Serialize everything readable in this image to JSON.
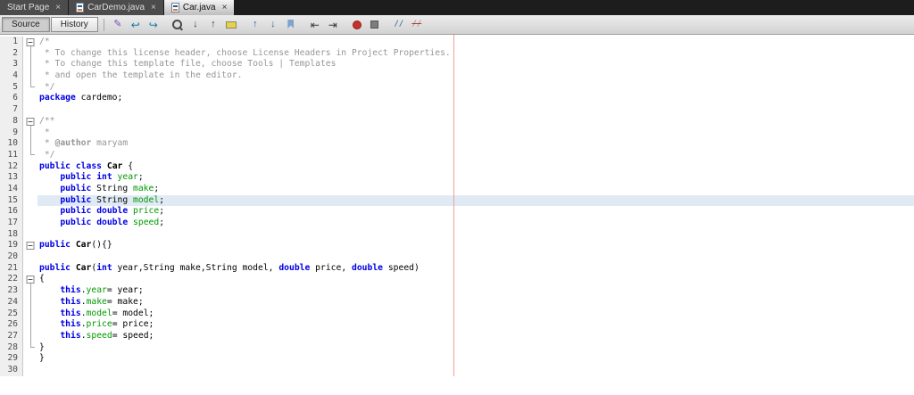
{
  "window": {
    "close_glyph": "×",
    "tabs": [
      {
        "label": "Start Page",
        "icon": "none",
        "active": false
      },
      {
        "label": "CarDemo.java",
        "icon": "java-file-icon",
        "active": false
      },
      {
        "label": "Car.java",
        "icon": "java-file-icon",
        "active": true
      }
    ]
  },
  "toolbar": {
    "source_label": "Source",
    "history_label": "History",
    "icon_groups": [
      [
        "last-edit",
        "back",
        "forward"
      ],
      [
        "find-selection",
        "find-next",
        "find-previous",
        "toggle-highlight"
      ],
      [
        "previous-bookmark",
        "next-bookmark",
        "toggle-bookmark"
      ],
      [
        "shift-left",
        "shift-right"
      ],
      [
        "start-macro",
        "stop-macro"
      ],
      [
        "comment",
        "uncomment"
      ]
    ]
  },
  "editor": {
    "language": "java",
    "line_count": 30,
    "margin_color": "#f49a9a",
    "lines": [
      {
        "f": "box",
        "t": [
          [
            "c",
            "/*"
          ]
        ]
      },
      {
        "f": "line",
        "t": [
          [
            "c",
            " * To change this license header, choose License Headers in Project Properties."
          ]
        ]
      },
      {
        "f": "line",
        "t": [
          [
            "c",
            " * To change this template file, choose Tools | Templates"
          ]
        ]
      },
      {
        "f": "line",
        "t": [
          [
            "c",
            " * and open the template in the editor."
          ]
        ]
      },
      {
        "f": "end",
        "t": [
          [
            "c",
            " */"
          ]
        ]
      },
      {
        "t": [
          [
            "k",
            "package"
          ],
          [
            "p",
            " cardemo;"
          ]
        ]
      },
      {
        "t": []
      },
      {
        "f": "box",
        "t": [
          [
            "c",
            "/**"
          ]
        ]
      },
      {
        "f": "line",
        "t": [
          [
            "c",
            " *"
          ]
        ]
      },
      {
        "f": "line",
        "t": [
          [
            "c",
            " * "
          ],
          [
            "cb",
            "@author"
          ],
          [
            "c",
            " maryam"
          ]
        ]
      },
      {
        "f": "end",
        "t": [
          [
            "c",
            " */"
          ]
        ]
      },
      {
        "t": [
          [
            "k",
            "public"
          ],
          [
            "p",
            " "
          ],
          [
            "k",
            "class"
          ],
          [
            "p",
            " "
          ],
          [
            "b",
            "Car"
          ],
          [
            "p",
            " {"
          ]
        ]
      },
      {
        "t": [
          [
            "p",
            "    "
          ],
          [
            "k",
            "public"
          ],
          [
            "p",
            " "
          ],
          [
            "k",
            "int"
          ],
          [
            "p",
            " "
          ],
          [
            "f",
            "year"
          ],
          [
            "p",
            ";"
          ]
        ]
      },
      {
        "t": [
          [
            "p",
            "    "
          ],
          [
            "k",
            "public"
          ],
          [
            "p",
            " String "
          ],
          [
            "f",
            "make"
          ],
          [
            "p",
            ";"
          ]
        ]
      },
      {
        "cur": true,
        "t": [
          [
            "p",
            "    "
          ],
          [
            "k",
            "public"
          ],
          [
            "p",
            " String "
          ],
          [
            "f",
            "model"
          ],
          [
            "p",
            ";"
          ]
        ]
      },
      {
        "t": [
          [
            "p",
            "    "
          ],
          [
            "k",
            "public"
          ],
          [
            "p",
            " "
          ],
          [
            "k",
            "double"
          ],
          [
            "p",
            " "
          ],
          [
            "f",
            "price"
          ],
          [
            "p",
            ";"
          ]
        ]
      },
      {
        "t": [
          [
            "p",
            "    "
          ],
          [
            "k",
            "public"
          ],
          [
            "p",
            " "
          ],
          [
            "k",
            "double"
          ],
          [
            "p",
            " "
          ],
          [
            "f",
            "speed"
          ],
          [
            "p",
            ";"
          ]
        ]
      },
      {
        "t": []
      },
      {
        "f": "box1",
        "t": [
          [
            "k",
            "public"
          ],
          [
            "p",
            " "
          ],
          [
            "b",
            "Car"
          ],
          [
            "p",
            "(){}"
          ]
        ]
      },
      {
        "t": []
      },
      {
        "t": [
          [
            "k",
            "public"
          ],
          [
            "p",
            " "
          ],
          [
            "b",
            "Car"
          ],
          [
            "p",
            "("
          ],
          [
            "k",
            "int"
          ],
          [
            "p",
            " year,String make,String model, "
          ],
          [
            "k",
            "double"
          ],
          [
            "p",
            " price, "
          ],
          [
            "k",
            "double"
          ],
          [
            "p",
            " speed)"
          ]
        ]
      },
      {
        "f": "box",
        "t": [
          [
            "p",
            "{"
          ]
        ]
      },
      {
        "f": "line",
        "t": [
          [
            "p",
            "    "
          ],
          [
            "k",
            "this"
          ],
          [
            "p",
            "."
          ],
          [
            "f",
            "year"
          ],
          [
            "p",
            "= year;"
          ]
        ]
      },
      {
        "f": "line",
        "t": [
          [
            "p",
            "    "
          ],
          [
            "k",
            "this"
          ],
          [
            "p",
            "."
          ],
          [
            "f",
            "make"
          ],
          [
            "p",
            "= make;"
          ]
        ]
      },
      {
        "f": "line",
        "t": [
          [
            "p",
            "    "
          ],
          [
            "k",
            "this"
          ],
          [
            "p",
            "."
          ],
          [
            "f",
            "model"
          ],
          [
            "p",
            "= model;"
          ]
        ]
      },
      {
        "f": "line",
        "t": [
          [
            "p",
            "    "
          ],
          [
            "k",
            "this"
          ],
          [
            "p",
            "."
          ],
          [
            "f",
            "price"
          ],
          [
            "p",
            "= price;"
          ]
        ]
      },
      {
        "f": "line",
        "t": [
          [
            "p",
            "    "
          ],
          [
            "k",
            "this"
          ],
          [
            "p",
            "."
          ],
          [
            "f",
            "speed"
          ],
          [
            "p",
            "= speed;"
          ]
        ]
      },
      {
        "f": "end",
        "t": [
          [
            "p",
            "}"
          ]
        ]
      },
      {
        "t": [
          [
            "p",
            "}"
          ]
        ]
      },
      {
        "t": []
      }
    ]
  }
}
